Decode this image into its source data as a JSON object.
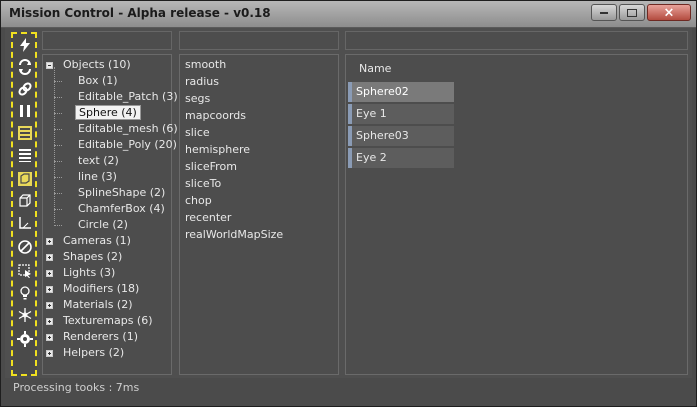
{
  "window": {
    "title": "Mission Control - Alpha release - v0.18"
  },
  "toolbar": {
    "icons": [
      "lightning-icon",
      "refresh-icon",
      "link-icon",
      "pause-icon",
      "list-selected-icon",
      "list-icon",
      "box-icon",
      "box-outline-icon",
      "corner-icon",
      "disabled-icon",
      "select-region-icon",
      "light-bulb-icon",
      "snowflake-icon",
      "settings-icon"
    ]
  },
  "tree": {
    "items": [
      {
        "label": "Objects (10)",
        "expanded": true
      },
      {
        "label": "Box (1)"
      },
      {
        "label": "Editable_Patch (3)"
      },
      {
        "label": "Sphere (4)",
        "selected": true
      },
      {
        "label": "Editable_mesh (6)"
      },
      {
        "label": "Editable_Poly (20)"
      },
      {
        "label": "text (2)"
      },
      {
        "label": "line (3)"
      },
      {
        "label": "SplineShape (2)"
      },
      {
        "label": "ChamferBox (4)"
      },
      {
        "label": "Circle (2)"
      },
      {
        "label": "Cameras (1)"
      },
      {
        "label": "Shapes (2)"
      },
      {
        "label": "Lights (3)"
      },
      {
        "label": "Modifiers (18)"
      },
      {
        "label": "Materials (2)"
      },
      {
        "label": "Texturemaps (6)"
      },
      {
        "label": "Renderers (1)"
      },
      {
        "label": "Helpers (2)"
      }
    ]
  },
  "properties": [
    "smooth",
    "radius",
    "segs",
    "mapcoords",
    "slice",
    "hemisphere",
    "sliceFrom",
    "sliceTo",
    "chop",
    "recenter",
    "realWorldMapSize"
  ],
  "list": {
    "header": "Name",
    "items": [
      "Sphere02",
      "Eye 1",
      "Sphere03",
      "Eye 2"
    ]
  },
  "status": "Processing tooks : 7ms"
}
